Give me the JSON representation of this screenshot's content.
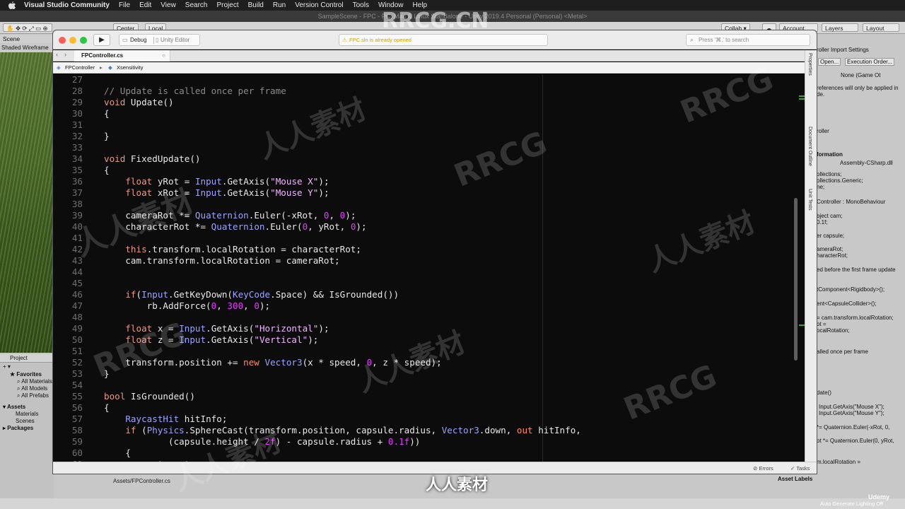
{
  "menubar": {
    "app_name": "Visual Studio Community",
    "items": [
      "File",
      "Edit",
      "View",
      "Search",
      "Project",
      "Build",
      "Run",
      "Version Control",
      "Tools",
      "Window",
      "Help"
    ]
  },
  "unity": {
    "window_title": "SampleScene - FPC - PC, Mac & Linux Standalone - Unity 2019.4 Personal (Personal) <Metal>",
    "toolbar": {
      "center_label": "Center",
      "local_label": "Local",
      "collab_label": "Collab ▾",
      "account_label": "Account",
      "layers_label": "Layers",
      "layout_label": "Layout"
    },
    "scene_tab": "Scene",
    "scene_mode": "Shaded Wireframe",
    "project": {
      "tab": "Project",
      "favorites": "Favorites",
      "fav_items": [
        "All Materials",
        "All Models",
        "All Prefabs"
      ],
      "assets": "Assets",
      "asset_items": [
        "Materials",
        "Scenes"
      ],
      "packages": "Packages"
    },
    "inspector_lines": [
      "roller Import Settings",
      "Open...",
      "Execution Order...",
      "None (Game Ot",
      "references will only be applied in",
      "de.",
      "roller",
      "formation",
      "Assembly-CSharp.dll",
      "ollections;",
      "ollections.Generic;",
      "ne;",
      "Controller : MonoBehaviour",
      "bject cam;",
      "0.1f;",
      "er capsule;",
      "ameraRot;",
      "haracterRot;",
      "ed before the first frame update",
      "tComponent<Rigidbody>();",
      "ent<CapsuleCollider>();",
      "= cam.transform.localRotation;",
      "ot =",
      "ocalRotation;",
      "alled once per frame",
      "date()",
      "Input.GetAxis(\"Mouse X\");",
      "Input.GetAxis(\"Mouse Y\");",
      "*= Quaternion.Euler(-xRot, 0,",
      "ot *= Quaternion.Euler(0, yRot,",
      "m.localRotation ="
    ],
    "asset_path": "Assets/FPController.cs",
    "asset_labels": "Asset Labels",
    "auto_generate": "Auto Generate Lighting Off",
    "udemy": "Udemy"
  },
  "vs": {
    "config": "Debug",
    "target": "Unity Editor",
    "status_message": "FPC.sln is already opened",
    "search_placeholder": "Press '⌘.' to search",
    "tab_label": "FPController.cs",
    "breadcrumb_class": "FPController",
    "breadcrumb_member": "Xsensitivity",
    "side_panels": [
      "Properties",
      "Document Outline",
      "Unit Tests"
    ],
    "status_errors": "Errors",
    "status_tasks": "Tasks"
  },
  "code_lines": [
    {
      "n": "27",
      "html": ""
    },
    {
      "n": "28",
      "html": "        <span class='c'>// Update is called once per frame</span>"
    },
    {
      "n": "29",
      "html": "        <span class='k'>void</span> Update()"
    },
    {
      "n": "30",
      "html": "        {"
    },
    {
      "n": "31",
      "html": ""
    },
    {
      "n": "32",
      "html": "        }"
    },
    {
      "n": "33",
      "html": ""
    },
    {
      "n": "34",
      "html": "        <span class='k'>void</span> FixedUpdate()"
    },
    {
      "n": "35",
      "html": "        {"
    },
    {
      "n": "36",
      "html": "            <span class='k'>float</span> yRot = <span class='t'>Input</span>.GetAxis(<span class='s'>\"Mouse X\"</span>);"
    },
    {
      "n": "37",
      "html": "            <span class='k'>float</span> xRot = <span class='t'>Input</span>.GetAxis(<span class='s'>\"Mouse Y\"</span>);"
    },
    {
      "n": "38",
      "html": ""
    },
    {
      "n": "39",
      "html": "            cameraRot *= <span class='t'>Quaternion</span>.Euler(-xRot, <span class='n'>0</span>, <span class='n'>0</span>);"
    },
    {
      "n": "40",
      "html": "            characterRot *= <span class='t'>Quaternion</span>.Euler(<span class='n'>0</span>, yRot, <span class='n'>0</span>);"
    },
    {
      "n": "41",
      "html": ""
    },
    {
      "n": "42",
      "html": "            <span class='k'>this</span>.transform.localRotation = characterRot;"
    },
    {
      "n": "43",
      "html": "            cam.transform.localRotation = cameraRot;"
    },
    {
      "n": "44",
      "html": ""
    },
    {
      "n": "45",
      "html": ""
    },
    {
      "n": "46",
      "html": "            <span class='k'>if</span>(<span class='t'>Input</span>.GetKeyDown(<span class='t'>KeyCode</span>.Space) &amp;&amp; IsGrounded())"
    },
    {
      "n": "47",
      "html": "                rb.AddForce(<span class='n'>0</span>, <span class='n'>300</span>, <span class='n'>0</span>);"
    },
    {
      "n": "48",
      "html": ""
    },
    {
      "n": "49",
      "html": "            <span class='k'>float</span> x = <span class='t'>Input</span>.GetAxis(<span class='s'>\"Horizontal\"</span>);"
    },
    {
      "n": "50",
      "html": "            <span class='k'>float</span> z = <span class='t'>Input</span>.GetAxis(<span class='s'>\"Vertical\"</span>);"
    },
    {
      "n": "51",
      "html": ""
    },
    {
      "n": "52",
      "html": "            transform.position += <span class='kw'>new</span> <span class='t'>Vector3</span>(x * speed, <span class='n'>0</span>, z * speed);"
    },
    {
      "n": "53",
      "html": "        }"
    },
    {
      "n": "54",
      "html": ""
    },
    {
      "n": "55",
      "html": "        <span class='k'>bool</span> IsGrounded()"
    },
    {
      "n": "56",
      "html": "        {"
    },
    {
      "n": "57",
      "html": "            <span class='t'>RaycastHit</span> hitInfo;"
    },
    {
      "n": "58",
      "html": "            <span class='k'>if</span> (<span class='t'>Physics</span>.SphereCast(transform.position, capsule.radius, <span class='t'>Vector3</span>.down, <span class='kw'>out</span> hitInfo,"
    },
    {
      "n": "59",
      "html": "                    (capsule.height / <span class='n'>2f</span>) - capsule.radius + <span class='n'>0.1f</span>))"
    },
    {
      "n": "60",
      "html": "            {"
    },
    {
      "n": "61",
      "html": "                <span class='k'>return</span> <span class='k'>true</span>;"
    }
  ],
  "watermarks": {
    "brand": "RRCG",
    "brand_top": "RRCG.CN",
    "cn": "人人素材"
  }
}
